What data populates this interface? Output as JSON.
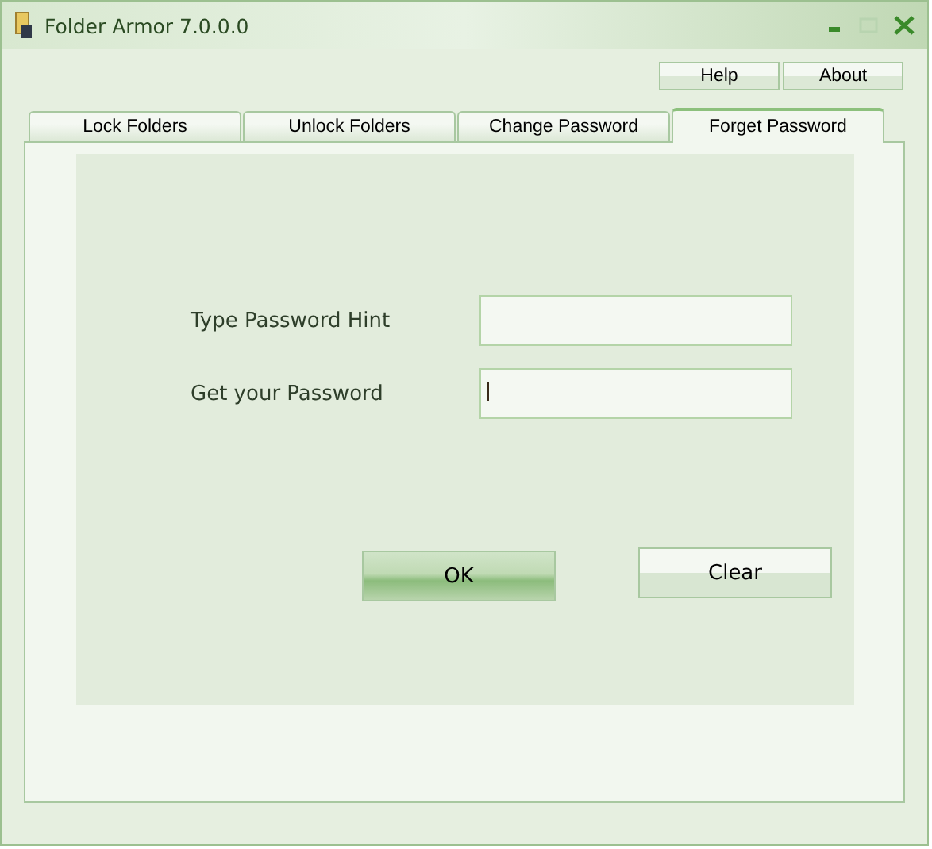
{
  "window": {
    "title": "Folder Armor 7.0.0.0"
  },
  "header_buttons": [
    "Help",
    "About"
  ],
  "tabs": [
    {
      "label": "Lock Folders",
      "selected": false
    },
    {
      "label": "Unlock Folders",
      "selected": false
    },
    {
      "label": "Change Password",
      "selected": false
    },
    {
      "label": "Forget Password",
      "selected": true
    }
  ],
  "fields": [
    {
      "label": "Type Password Hint",
      "focused": false
    },
    {
      "label": "Get your Password",
      "focused": true
    }
  ],
  "buttons": [
    {
      "label": "OK",
      "default": true
    },
    {
      "label": "Clear",
      "default": false
    }
  ]
}
